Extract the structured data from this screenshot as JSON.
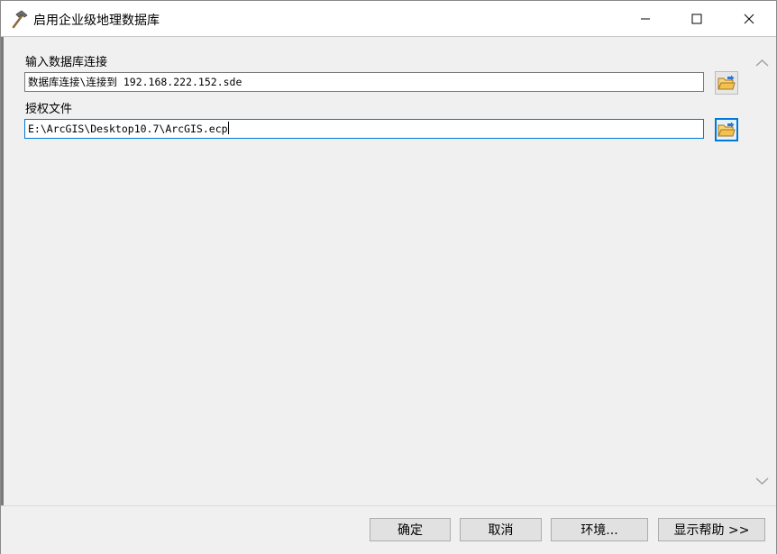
{
  "window": {
    "title": "启用企业级地理数据库",
    "icon": "hammer-icon"
  },
  "form": {
    "fields": [
      {
        "label": "输入数据库连接",
        "value": "数据库连接\\连接到 192.168.222.152.sde",
        "browse_icon": "open-folder-icon"
      },
      {
        "label": "授权文件",
        "value": "E:\\ArcGIS\\Desktop10.7\\ArcGIS.ecp",
        "browse_icon": "open-folder-icon"
      }
    ]
  },
  "footer": {
    "ok_label": "确定",
    "cancel_label": "取消",
    "environments_label": "环境...",
    "help_label": "显示帮助 >>"
  },
  "colors": {
    "focus": "#0078d7",
    "folder": "#f2c24f"
  }
}
